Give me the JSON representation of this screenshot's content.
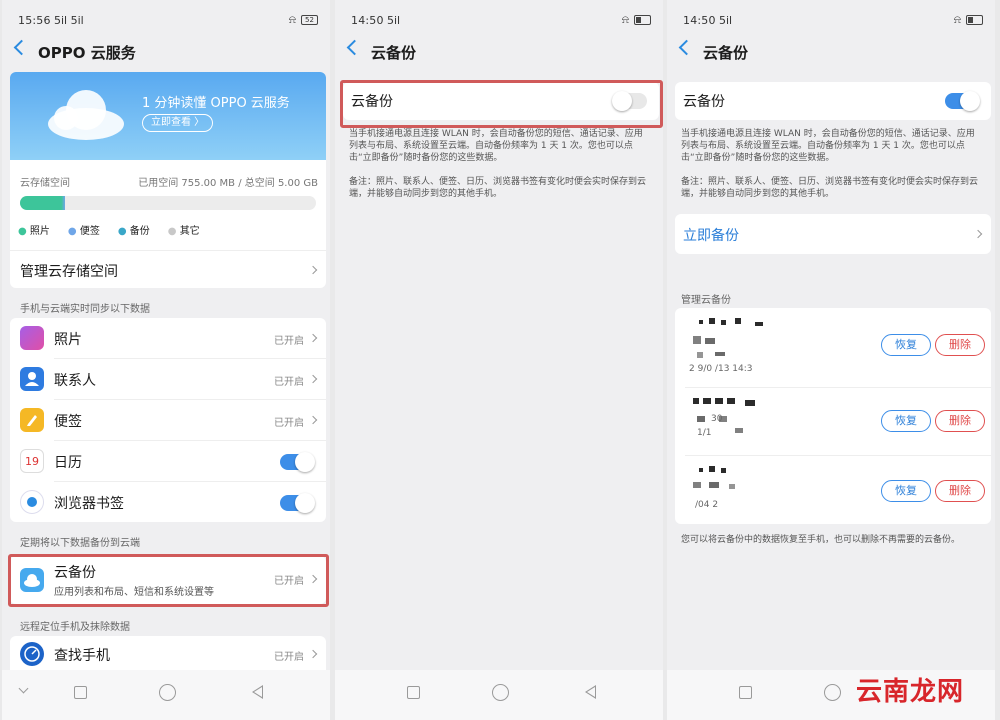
{
  "screen1": {
    "status_time": "15:56",
    "status_signal": "5il 5il",
    "battery": "52",
    "title": "OPPO 云服务",
    "banner": {
      "text": "1 分钟读懂 OPPO 云服务",
      "button": "立即查看 〉"
    },
    "storage": {
      "label": "云存储空间",
      "info": "已用空间 755.00 MB / 总空间 5.00 GB",
      "used_fraction": 0.151,
      "legend": [
        "照片",
        "便签",
        "备份",
        "其它"
      ],
      "legend_colors": [
        "#3dc59a",
        "#6fa6e8",
        "#3aa7c8",
        "#c8c8c8"
      ]
    },
    "manage": "管理云存储空间",
    "section_sync": "手机与云端实时同步以下数据",
    "sync_items": [
      {
        "label": "照片",
        "state": "已开启",
        "icon": "photos-icon"
      },
      {
        "label": "联系人",
        "state": "已开启",
        "icon": "contacts-icon"
      },
      {
        "label": "便签",
        "state": "已开启",
        "icon": "notes-icon"
      },
      {
        "label": "日历",
        "icon": "calendar-icon",
        "calendar_day": "19"
      },
      {
        "label": "浏览器书签",
        "icon": "browser-icon"
      }
    ],
    "section_backup": "定期将以下数据备份到云端",
    "backup": {
      "label": "云备份",
      "sub": "应用列表和布局、短信和系统设置等",
      "state": "已开启"
    },
    "section_find": "远程定位手机及抹除数据",
    "find_phone": {
      "label": "查找手机",
      "state": "已开启"
    }
  },
  "screen2": {
    "status_time": "14:50",
    "status_signal": "5il",
    "title": "云备份",
    "toggle_label": "云备份",
    "desc": "当手机接通电源且连接 WLAN 时，会自动备份您的短信、通话记录、应用列表与布局、系统设置至云端。自动备份频率为 1 天 1 次。您也可以点击“立即备份”随时备份您的这些数据。",
    "note": "备注：照片、联系人、便签、日历、浏览器书签有变化时便会实时保存到云端，并能够自动同步到您的其他手机。"
  },
  "screen3": {
    "status_time": "14:50",
    "status_signal": "5il",
    "title": "云备份",
    "toggle_label": "云备份",
    "desc": "当手机接通电源且连接 WLAN 时，会自动备份您的短信、通话记录、应用列表与布局、系统设置至云端。自动备份频率为 1 天 1 次。您也可以点击“立即备份”随时备份您的这些数据。",
    "note": "备注：照片、联系人、便签、日历、浏览器书签有变化时便会实时保存到云端，并能够自动同步到您的其他手机。",
    "backup_now": "立即备份",
    "manage_title": "管理云备份",
    "entries": [
      {
        "restore": "恢复",
        "delete": "删除",
        "partial_date": "2 9/0 /13 14:3"
      },
      {
        "restore": "恢复",
        "delete": "删除",
        "partial_text": "30",
        "partial_date": "1/1"
      },
      {
        "restore": "恢复",
        "delete": "删除",
        "partial_date": "/04 2"
      }
    ],
    "footer": "您可以将云备份中的数据恢复至手机，也可以删除不再需要的云备份。"
  },
  "watermark": "云南龙网",
  "colors": {
    "accent": "#3d8ee8",
    "highlight": "#d05a5a",
    "delete": "#e04848"
  }
}
